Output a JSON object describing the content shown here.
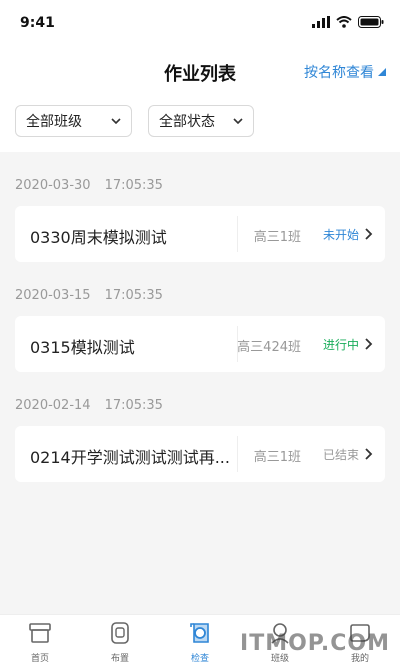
{
  "status_bar": {
    "time": "9:41"
  },
  "nav": {
    "title": "作业列表",
    "action_label": "按名称查看"
  },
  "filters": [
    {
      "label": "全部班级"
    },
    {
      "label": "全部状态"
    }
  ],
  "groups": [
    {
      "date": "2020-03-30",
      "time": "17:05:35",
      "item": {
        "title": "0330周末模拟测试",
        "class": "高三1班",
        "status": "未开始",
        "status_color": "#2f86d6"
      }
    },
    {
      "date": "2020-03-15",
      "time": "17:05:35",
      "item": {
        "title": "0315模拟测试",
        "class": "高三424班",
        "status": "进行中",
        "status_color": "#1aad5b"
      }
    },
    {
      "date": "2020-02-14",
      "time": "17:05:35",
      "item": {
        "title": "0214开学测试测试测试再...",
        "class": "高三1班",
        "status": "已结束",
        "status_color": "#999999"
      }
    }
  ],
  "tabs": [
    {
      "label": "首页",
      "icon": "home-icon",
      "active": false
    },
    {
      "label": "布置",
      "icon": "assign-icon",
      "active": false
    },
    {
      "label": "检查",
      "icon": "check-icon",
      "active": true
    },
    {
      "label": "班级",
      "icon": "class-icon",
      "active": false
    },
    {
      "label": "我的",
      "icon": "profile-icon",
      "active": false
    }
  ],
  "watermark": "ITMOP.COM",
  "colors": {
    "accent": "#2f86d6",
    "background": "#f5f5f5"
  }
}
